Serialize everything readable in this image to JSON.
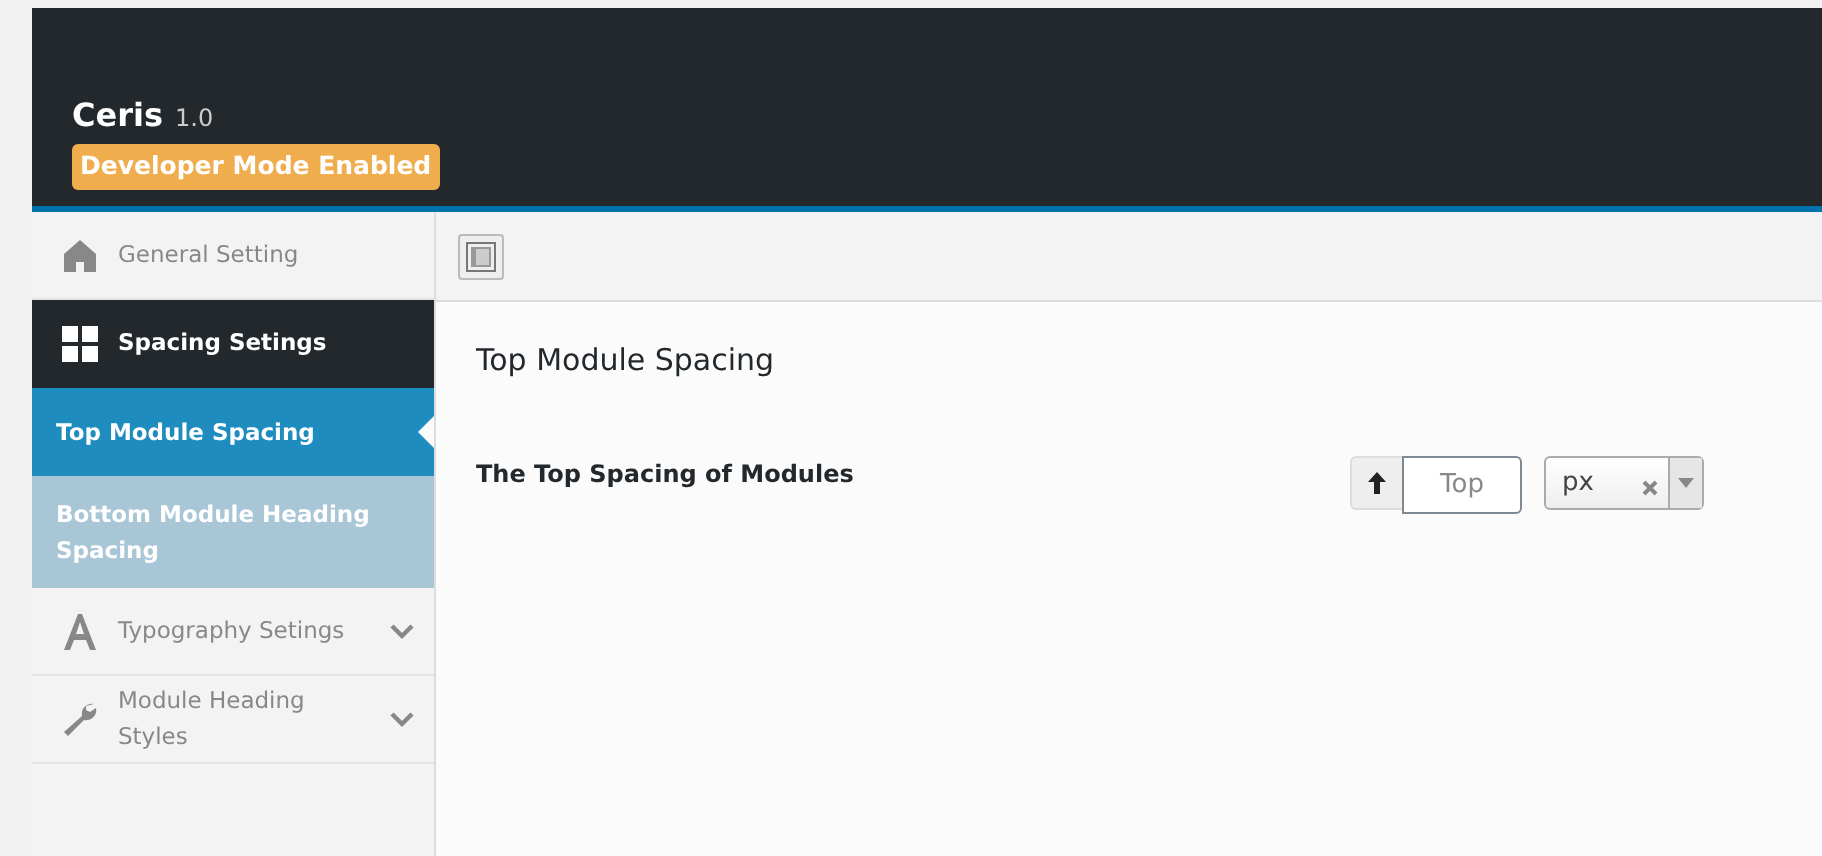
{
  "header": {
    "title": "Ceris",
    "version": "1.0",
    "badge": "Developer Mode Enabled"
  },
  "sidebar": {
    "items": [
      {
        "label": "General Setting",
        "kind": "link",
        "selected": false
      },
      {
        "label": "Spacing Setings",
        "kind": "group",
        "selected": true,
        "expanded": true,
        "children": [
          {
            "label": "Top Module Spacing",
            "selected": true
          },
          {
            "label": "Bottom Module Heading Spacing",
            "selected": false
          }
        ]
      },
      {
        "label": "Typography Setings",
        "kind": "group",
        "selected": false,
        "expanded": false
      },
      {
        "label": "Module Heading Styles",
        "kind": "group",
        "selected": false,
        "expanded": false
      }
    ]
  },
  "section": {
    "title": "Top Module Spacing",
    "fields": [
      {
        "label": "The Top Spacing of Modules",
        "placeholder": "Top",
        "unit": "px"
      }
    ]
  }
}
